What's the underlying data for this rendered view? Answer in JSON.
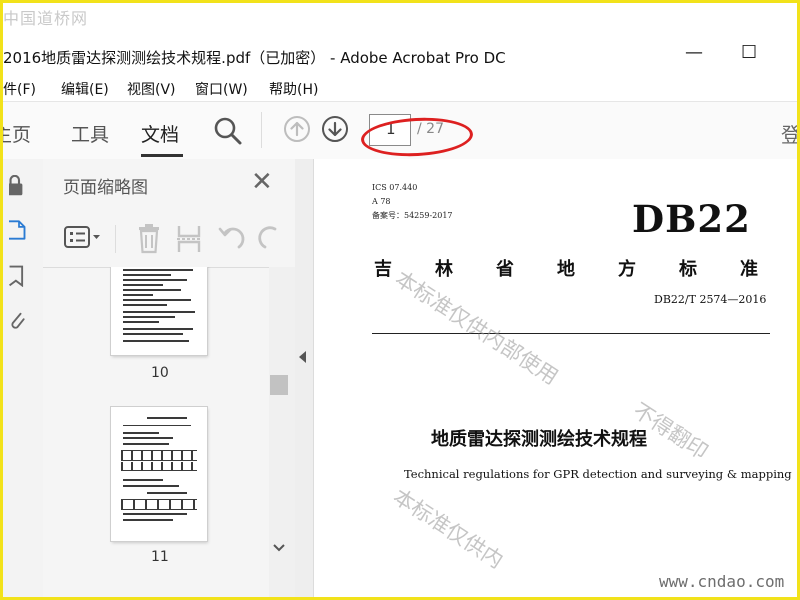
{
  "watermark_top": "中国道桥网",
  "window": {
    "title": "2016地质雷达探测测绘技术规程.pdf（已加密） - Adobe Acrobat Pro DC",
    "minimize_glyph": "—",
    "maximize_glyph": "☐"
  },
  "menu": [
    "件(F)",
    "编辑(E)",
    "视图(V)",
    "窗口(W)",
    "帮助(H)"
  ],
  "tabs": {
    "home": "主页",
    "tools": "工具",
    "document": "文档"
  },
  "toolbar": {
    "icons": [
      "search-icon",
      "prev-page-icon",
      "next-page-icon"
    ],
    "current_page": "1",
    "total_pages": "/ 27",
    "right_cut": "登"
  },
  "panel": {
    "title": "页面缩略图",
    "thumbnails": [
      {
        "label": "10"
      },
      {
        "label": "11"
      }
    ]
  },
  "document": {
    "meta": [
      "ICS 07.440",
      "A 78",
      "备案号：54259-2017"
    ],
    "code": "DB22",
    "province": [
      "吉",
      "林",
      "省",
      "地",
      "方",
      "标",
      "准"
    ],
    "std_number": "DB22/T 2574—2016",
    "title_cn": "地质雷达探测测绘技术规程",
    "title_en": "Technical regulations for GPR detection and surveying & mapping",
    "watermarks": [
      "本标准仅供内部使用",
      "不得翻印",
      "本标准仅供内"
    ]
  },
  "site_watermark": "www.cndao.com",
  "colors": {
    "frame": "#f2e21a",
    "annotation_oval": "#dd2020"
  }
}
